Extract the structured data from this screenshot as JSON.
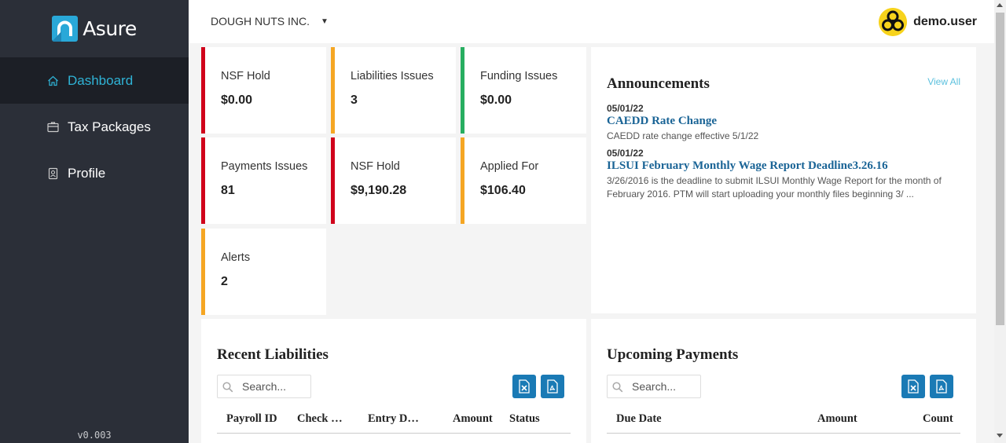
{
  "app": {
    "brand": "Asure",
    "version": "v0.003"
  },
  "sidebar": {
    "items": [
      {
        "label": "Dashboard",
        "icon": "home-icon",
        "active": true
      },
      {
        "label": "Tax Packages",
        "icon": "package-icon",
        "active": false
      },
      {
        "label": "Profile",
        "icon": "badge-icon",
        "active": false
      }
    ]
  },
  "header": {
    "company": "DOUGH NUTS INC.",
    "username": "demo.user"
  },
  "cards": [
    {
      "label": "NSF Hold",
      "value": "$0.00",
      "color": "#d0021b"
    },
    {
      "label": "Liabilities Issues",
      "value": "3",
      "color": "#f5a623"
    },
    {
      "label": "Funding Issues",
      "value": "$0.00",
      "color": "#27ae60"
    },
    {
      "label": "Payments Issues",
      "value": "81",
      "color": "#d0021b"
    },
    {
      "label": "NSF Hold",
      "value": "$9,190.28",
      "color": "#d0021b"
    },
    {
      "label": "Applied For",
      "value": "$106.40",
      "color": "#f5a623"
    },
    {
      "label": "Alerts",
      "value": "2",
      "color": "#f5a623"
    }
  ],
  "announcements": {
    "title": "Announcements",
    "view_all": "View All",
    "items": [
      {
        "date": "05/01/22",
        "title": "CAEDD Rate Change",
        "body": "CAEDD rate change effective 5/1/22"
      },
      {
        "date": "05/01/22",
        "title": "ILSUI February Monthly Wage Report Deadline3.26.16",
        "body": "3/26/2016 is the deadline to submit ILSUI Monthly Wage Report for the month of February 2016. PTM will start uploading your monthly files beginning 3/ ..."
      }
    ]
  },
  "recent_liabilities": {
    "title": "Recent Liabilities",
    "search_placeholder": "Search...",
    "columns": [
      "Payroll ID",
      "Check Date",
      "Entry Date",
      "Amount",
      "Status"
    ]
  },
  "upcoming_payments": {
    "title": "Upcoming Payments",
    "search_placeholder": "Search...",
    "columns": [
      "Due Date",
      "Amount",
      "Count"
    ]
  }
}
